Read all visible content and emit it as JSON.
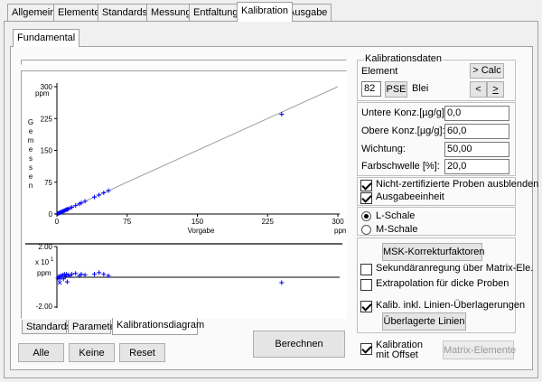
{
  "main_tabs": [
    "Allgemein",
    "Elemente",
    "Standards",
    "Messung",
    "Entfaltung",
    "Kalibration",
    "Ausgabe"
  ],
  "sub_tab": "Fundamental",
  "calib": {
    "group_title": "Kalibrationsdaten",
    "element_label": "Element",
    "element_number": "82",
    "pse_label": "PSE",
    "element_name": "Blei",
    "calc_label": "> Calc",
    "prev_label": "<",
    "next_label": ">"
  },
  "fields": [
    {
      "label": "Untere Konz.[µg/g]:",
      "value": "0,0"
    },
    {
      "label": "Obere Konz.[µg/g]:",
      "value": "60,0"
    },
    {
      "label": "Wichtung:",
      "value": "50,00"
    },
    {
      "label": "Farbschwelle [%]:",
      "value": "20,0"
    }
  ],
  "checks1": [
    {
      "label": "Nicht-zertifizierte Proben ausblenden",
      "checked": true
    },
    {
      "label": "Ausgabeeinheit",
      "checked": true
    }
  ],
  "scale": [
    {
      "label": "L-Schale",
      "selected": true
    },
    {
      "label": "M-Schale",
      "selected": false
    }
  ],
  "msk_label": "MSK-Korrekturfaktoren",
  "checks2": [
    {
      "label": "Sekundäranregung über Matrix-Ele.",
      "checked": false
    },
    {
      "label": "Extrapolation für dicke Proben",
      "checked": false
    },
    {
      "label": "Kalib. inkl. Linien-Überlagerungen",
      "checked": true
    }
  ],
  "overlap_label": "Überlagerte Linien",
  "bottom": {
    "offset_line1": "Kalibration",
    "offset_line2": "mit Offset",
    "offset_checked": true,
    "matrix_label": "Matrix-Elemente",
    "berechnen_label": "Berechnen",
    "alle_label": "Alle",
    "keine_label": "Keine",
    "reset_label": "Reset"
  },
  "chart_tabs": [
    "Standards",
    "Parameter",
    "Kalibrationsdiagram"
  ],
  "chart_data": [
    {
      "type": "scatter",
      "ylabel": "Gemessen",
      "xlabel": "Vorgabe",
      "xunit": "ppm",
      "yunit": "ppm",
      "xlim": [
        0,
        300
      ],
      "ylim": [
        0,
        300
      ],
      "xticks": [
        "0",
        "75",
        "150",
        "225",
        "300"
      ],
      "yticks": [
        "0",
        "75",
        "150",
        "225",
        "300"
      ],
      "line": {
        "from": [
          0,
          0
        ],
        "to": [
          300,
          300
        ]
      },
      "marker_color": "#0000ff",
      "x": [
        1,
        2,
        3,
        4,
        5,
        6,
        7,
        8,
        9,
        10,
        11,
        12,
        14,
        16,
        20,
        24,
        26,
        30,
        40,
        45,
        50,
        55,
        240
      ],
      "y": [
        1,
        2,
        3,
        4,
        5,
        6,
        7,
        8,
        9,
        10,
        11,
        12,
        14,
        16,
        20,
        24,
        26,
        30,
        40,
        45,
        50,
        55,
        235
      ]
    },
    {
      "type": "scatter",
      "ylabel": "ppm",
      "yunit_label": "x 10",
      "yunit_exp": "1",
      "xlim": [
        0,
        300
      ],
      "ylim": [
        -2,
        2
      ],
      "yticks": [
        "2.00",
        "-2.00"
      ],
      "marker_color": "#0000ff",
      "x": [
        1,
        2,
        3,
        4,
        5,
        6,
        7,
        8,
        9,
        10,
        11,
        12,
        14,
        16,
        20,
        24,
        26,
        30,
        40,
        45,
        50,
        55,
        240
      ],
      "y": [
        -0.05,
        0.05,
        -0.1,
        0.1,
        0.0,
        0.15,
        -0.1,
        0.2,
        0.05,
        0.2,
        -0.3,
        0.15,
        0.1,
        0.2,
        0.25,
        0.1,
        0.2,
        0.15,
        0.2,
        0.3,
        0.2,
        0.1,
        -0.35
      ]
    }
  ]
}
